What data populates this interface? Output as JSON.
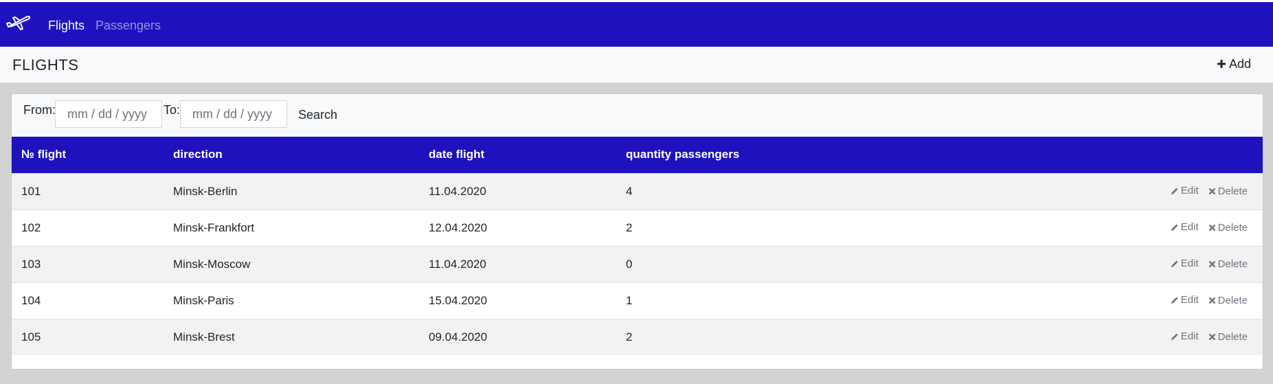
{
  "nav": {
    "brand_icon": "airplane-icon",
    "items": [
      {
        "label": "Flights",
        "active": true
      },
      {
        "label": "Passengers",
        "active": false
      }
    ]
  },
  "header": {
    "title": "FLIGHTS",
    "add_label": "Add"
  },
  "filter": {
    "from_label": "From:",
    "to_label": "To:",
    "from_placeholder": "mm / dd / yyyy",
    "to_placeholder": "mm / dd / yyyy",
    "search_label": "Search"
  },
  "table": {
    "columns": [
      "№ flight",
      "direction",
      "date flight",
      "quantity passengers"
    ],
    "rows": [
      {
        "flight": "101",
        "direction": "Minsk-Berlin",
        "date": "11.04.2020",
        "passengers": "4"
      },
      {
        "flight": "102",
        "direction": "Minsk-Frankfort",
        "date": "12.04.2020",
        "passengers": "2"
      },
      {
        "flight": "103",
        "direction": "Minsk-Moscow",
        "date": "11.04.2020",
        "passengers": "0"
      },
      {
        "flight": "104",
        "direction": "Minsk-Paris",
        "date": "15.04.2020",
        "passengers": "1"
      },
      {
        "flight": "105",
        "direction": "Minsk-Brest",
        "date": "09.04.2020",
        "passengers": "2"
      }
    ],
    "edit_label": "Edit",
    "delete_label": "Delete"
  },
  "colors": {
    "navbar": "#1f11bd",
    "header_bg": "#f8f9fa",
    "page_bg": "#d3d3d3",
    "action_text": "#6c757d"
  }
}
